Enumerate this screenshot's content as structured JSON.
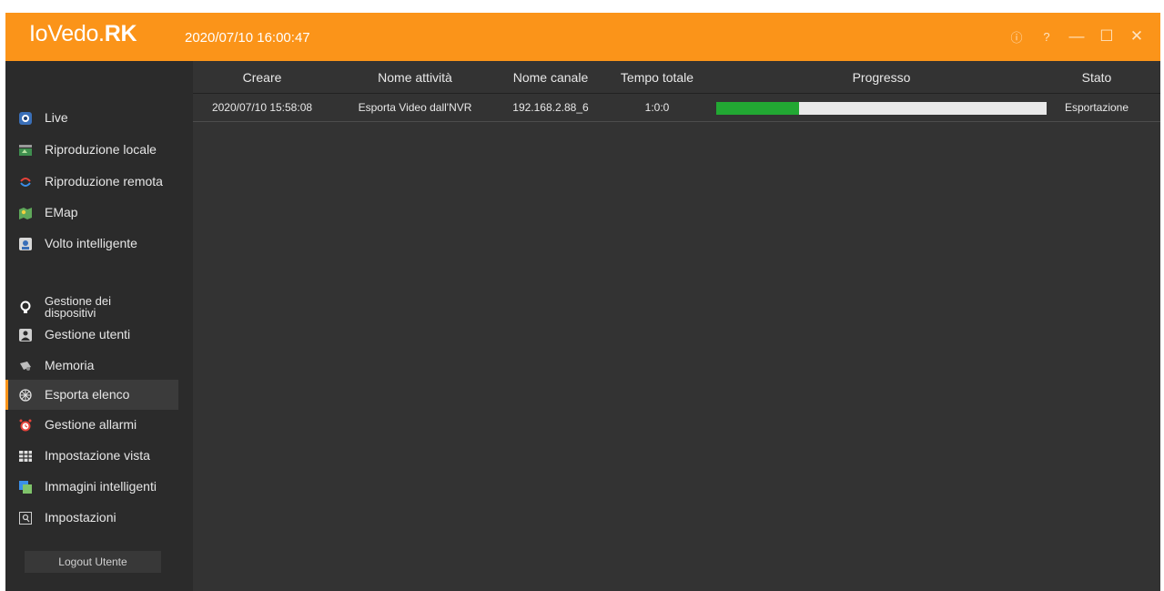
{
  "app": {
    "logo_prefix": "IoVedo.",
    "logo_bold": "RK",
    "datetime": "2020/07/10 16:00:47",
    "accent_color": "#fb9419"
  },
  "window_controls": [
    {
      "name": "about",
      "icon": "info-circle-icon",
      "glyph": "ⓘ"
    },
    {
      "name": "help",
      "icon": "help-circle-icon",
      "glyph": "?"
    },
    {
      "name": "minimize",
      "icon": "minimize-icon",
      "glyph": "—"
    },
    {
      "name": "maximize",
      "icon": "maximize-icon",
      "glyph": "☐"
    },
    {
      "name": "close",
      "icon": "close-icon",
      "glyph": "✕"
    }
  ],
  "sidebar": {
    "items": [
      {
        "label": "Live",
        "icon": "live-camera-icon"
      },
      {
        "label": "Riproduzione locale",
        "icon": "local-playback-icon"
      },
      {
        "label": "Riproduzione remota",
        "icon": "remote-playback-icon"
      },
      {
        "label": "EMap",
        "icon": "map-icon"
      },
      {
        "label": "Volto intelligente",
        "icon": "face-recognition-icon"
      },
      {
        "label": "Gestione dei dispositivi",
        "icon": "device-management-icon"
      },
      {
        "label": "Gestione utenti",
        "icon": "user-management-icon"
      },
      {
        "label": "Memoria",
        "icon": "storage-icon"
      },
      {
        "label": "Esporta elenco",
        "icon": "export-list-icon",
        "active": true
      },
      {
        "label": "Gestione allarmi",
        "icon": "alarm-clock-icon"
      },
      {
        "label": "Impostazione vista",
        "icon": "view-layout-icon"
      },
      {
        "label": "Immagini intelligenti",
        "icon": "smart-images-icon"
      },
      {
        "label": "Impostazioni",
        "icon": "settings-icon"
      }
    ],
    "logout_label": "Logout Utente"
  },
  "table": {
    "columns": [
      "Creare",
      "Nome attività",
      "Nome canale",
      "Tempo totale",
      "Progresso",
      "Stato"
    ],
    "rows": [
      {
        "created": "2020/07/10 15:58:08",
        "task_name": "Esporta Video dall'NVR",
        "channel_name": "192.168.2.88_6",
        "total_time": "1:0:0",
        "progress": 0.25,
        "status": "Esportazione"
      }
    ],
    "progress_color": "#22a833"
  }
}
